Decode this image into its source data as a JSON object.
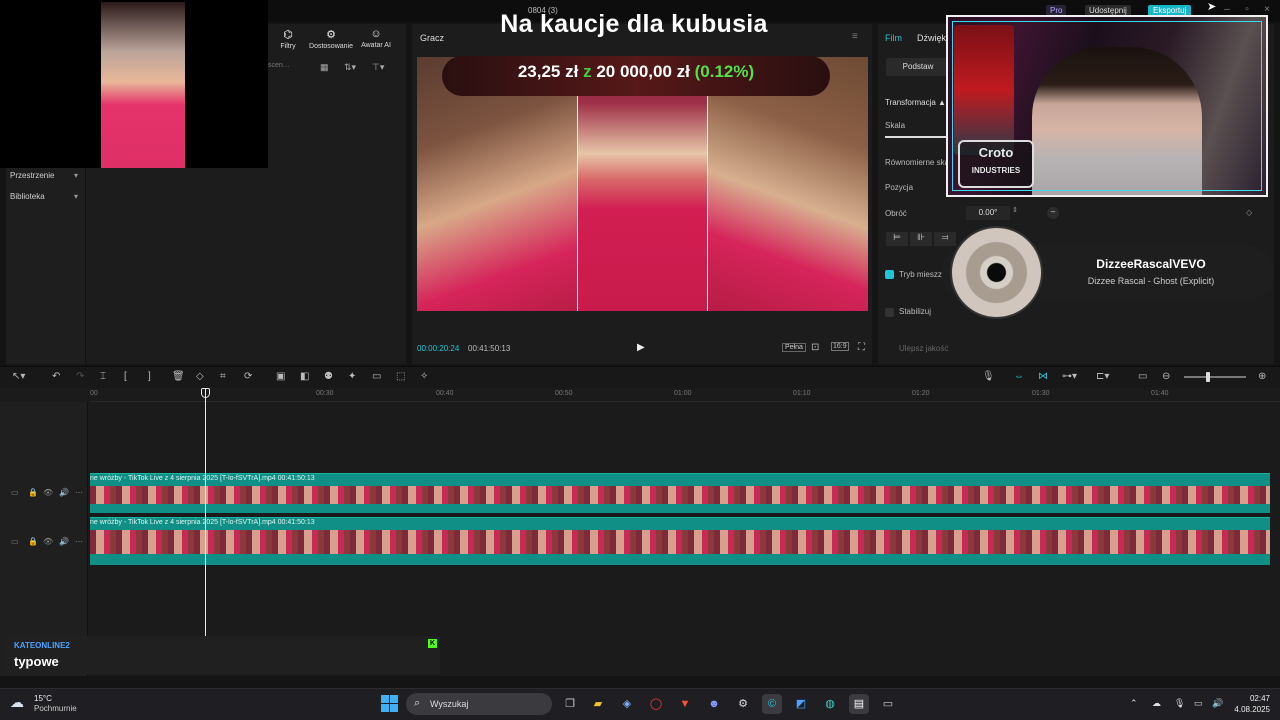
{
  "window": {
    "doc_title": "0804 (3)",
    "pro_label": "Pro",
    "share_label": "Udostępnij",
    "export_label": "Eksportuj"
  },
  "left_panel": {
    "tabs": [
      {
        "label": "Filtry",
        "icon": "filter-icon"
      },
      {
        "label": "Dostosowanie",
        "icon": "adjust-icon"
      },
      {
        "label": "Awatar AI",
        "icon": "avatar-icon"
      }
    ],
    "search_placeholder": "scen…",
    "sidebar": [
      {
        "label": "Przestrzenie"
      },
      {
        "label": "Biblioteka"
      }
    ]
  },
  "player": {
    "title": "Gracz",
    "current_time": "00:00:20:24",
    "total_time": "00:41:50:13",
    "full_label": "Pełna"
  },
  "overlay": {
    "headline": "Na kaucje dla kubusia",
    "raised": "23,25 zł",
    "of": "z",
    "goal": "20 000,00 zł",
    "percent": "(0.12%)"
  },
  "properties": {
    "tabs": [
      "Film",
      "Dźwięk"
    ],
    "basic_label": "Podstaw",
    "transform_label": "Transformacja ▲",
    "scale_label": "Skala",
    "uniform_label": "Równomierne skalo",
    "position_label": "Pozycja",
    "rotation_label": "Obróć",
    "rotation_value": "0.00°",
    "blend_label": "Tryb mieszz",
    "stabilize_label": "Stabilizuj",
    "quality_label": "Ulepsz jakość"
  },
  "music": {
    "artist": "DizzeeRascalVEVO",
    "title": "Dizzee Rascal - Ghost (Explicit)"
  },
  "webcam_logo": {
    "line1": "Croto",
    "line2": "INDUSTRIES"
  },
  "timeline": {
    "ruler_ticks": [
      "00",
      "00:30",
      "00:40",
      "00:50",
      "01:00",
      "01:10",
      "01:20",
      "01:30",
      "01:40"
    ],
    "clips": [
      {
        "label": "ne wróżby - TikTok Live z 4 sierpnia 2025 [T-lo-fSVTrA].mp4   00:41:50:13"
      },
      {
        "label": "ne wróżby - TikTok Live z 4 sierpnia 2025 [T-lo-fSVTrA].mp4   00:41:50:13"
      }
    ]
  },
  "chat": {
    "username": "KATEONLINE2",
    "message": "typowe",
    "badge": "K"
  },
  "taskbar": {
    "weather_temp": "15°C",
    "weather_desc": "Pochmurnie",
    "search_label": "Wyszukaj",
    "time": "02:47",
    "date": "4.08.2025"
  },
  "colors": {
    "accent": "#21c5d8",
    "clip": "#0f8f86",
    "kick": "#53fc18",
    "chat_user": "#4aa3ff"
  }
}
